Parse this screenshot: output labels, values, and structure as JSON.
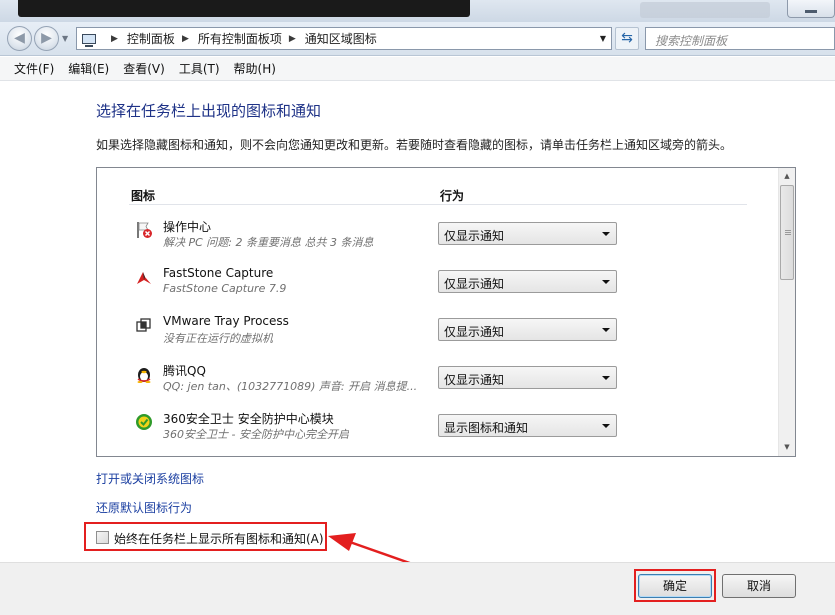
{
  "window": {
    "minimize_label": ""
  },
  "nav": {
    "back_glyph": "◀",
    "forward_glyph": "▶",
    "breadcrumbs": [
      "控制面板",
      "所有控制面板项",
      "通知区域图标"
    ],
    "search_placeholder": "搜索控制面板"
  },
  "menu": [
    "文件(F)",
    "编辑(E)",
    "查看(V)",
    "工具(T)",
    "帮助(H)"
  ],
  "main": {
    "heading": "选择在任务栏上出现的图标和通知",
    "description": "如果选择隐藏图标和通知，则不会向您通知更改和更新。若要随时查看隐藏的图标，请单击任务栏上通知区域旁的箭头。",
    "columns": {
      "icon": "图标",
      "behavior": "行为"
    },
    "items": [
      {
        "name": "操作中心",
        "sub": "解决 PC 问题: 2 条重要消息 总共 3 条消息",
        "behavior": "仅显示通知",
        "icon": "action-center-flag-icon"
      },
      {
        "name": "FastStone Capture",
        "sub": "FastStone Capture 7.9",
        "behavior": "仅显示通知",
        "icon": "faststone-capture-icon"
      },
      {
        "name": "VMware Tray Process",
        "sub": "没有正在运行的虚拟机",
        "behavior": "仅显示通知",
        "icon": "vmware-tray-icon"
      },
      {
        "name": "腾讯QQ",
        "sub": "QQ: jen tan、(1032771089) 声音: 开启 消息提...",
        "behavior": "仅显示通知",
        "icon": "qq-penguin-icon"
      },
      {
        "name": "360安全卫士 安全防护中心模块",
        "sub": "360安全卫士 - 安全防护中心完全开启",
        "behavior": "显示图标和通知",
        "icon": "360-safe-icon"
      }
    ],
    "links": {
      "system_icons": "打开或关闭系统图标",
      "restore_defaults": "还原默认图标行为"
    },
    "always_show_label": "始终在任务栏上显示所有图标和通知(A)",
    "always_show_checked": false
  },
  "buttons": {
    "ok": "确定",
    "cancel": "取消"
  },
  "colors": {
    "annotation_red": "#e31f1f",
    "heading_blue": "#1e3287",
    "link_blue": "#1b3fa1"
  }
}
